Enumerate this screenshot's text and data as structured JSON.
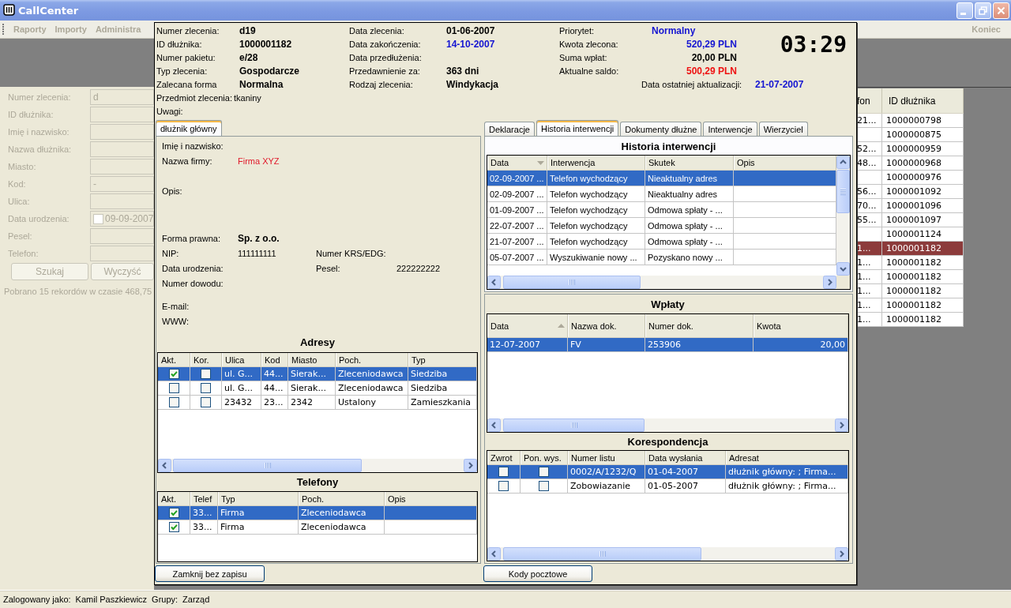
{
  "window": {
    "title": "CallCenter"
  },
  "menu": {
    "items": [
      {
        "label": "Raporty",
        "disabled": true
      },
      {
        "label": "Importy",
        "disabled": true
      },
      {
        "label": "Administra",
        "disabled": true
      }
    ],
    "end_item": {
      "label": "Koniec",
      "disabled": true
    }
  },
  "search_form": {
    "disabled": true,
    "fields": [
      {
        "kind": "text",
        "label": "Numer zlecenia:",
        "value": "d"
      },
      {
        "kind": "text",
        "label": "ID dłużnika:"
      },
      {
        "kind": "text",
        "label": "Imię i nazwisko:"
      },
      {
        "kind": "text",
        "label": "Nazwa dłużnika:"
      },
      {
        "kind": "text",
        "label": "Miasto:"
      },
      {
        "kind": "text",
        "label": "Kod:",
        "value": "-"
      },
      {
        "kind": "text",
        "label": "Ulica:"
      },
      {
        "kind": "date",
        "label": "Data urodzenia:",
        "value": "09-09-2007",
        "checked": false
      },
      {
        "kind": "text",
        "label": "Pesel:"
      },
      {
        "kind": "text",
        "label": "Telefon:"
      }
    ],
    "buttons": [
      "Szukaj",
      "Wyczyść"
    ],
    "status": "Pobrano 15 rekordów w czasie 468,75"
  },
  "results": {
    "columns": [
      "fon",
      "ID dłużnika"
    ],
    "rows": [
      {
        "column_1": "21...",
        "debtor_id": "1000000798",
        "selected": false
      },
      {
        "debtor_id": "1000000875",
        "selected": false
      },
      {
        "column_1": "52...",
        "debtor_id": "1000000959",
        "selected": false
      },
      {
        "column_1": "48...",
        "debtor_id": "1000000968",
        "selected": false
      },
      {
        "debtor_id": "1000000976",
        "selected": false
      },
      {
        "column_1": "56...",
        "debtor_id": "1000001092",
        "selected": false
      },
      {
        "column_1": "70...",
        "debtor_id": "1000001096",
        "selected": false
      },
      {
        "column_1": "55...",
        "debtor_id": "1000001097",
        "selected": false
      },
      {
        "debtor_id": "1000001124",
        "selected": false
      },
      {
        "column_1": "1...",
        "debtor_id": "1000001182",
        "selected": true
      },
      {
        "column_1": "1...",
        "debtor_id": "1000001182",
        "selected": false
      },
      {
        "column_1": "1...",
        "debtor_id": "1000001182",
        "selected": false
      },
      {
        "column_1": "1...",
        "debtor_id": "1000001182",
        "selected": false
      },
      {
        "column_1": "1...",
        "debtor_id": "1000001182",
        "selected": false
      },
      {
        "column_1": "1...",
        "debtor_id": "1000001182",
        "selected": false
      }
    ]
  },
  "order_dialog": {
    "summary": {
      "columns": [
        [
          {
            "label": "Numer zlecenia:",
            "value": "d19"
          },
          {
            "label": "ID dłużnika:",
            "value": "1000001182"
          },
          {
            "label": "Numer pakietu:",
            "value": "e/28"
          },
          {
            "label": "Typ zlecenia:",
            "value": "Gospodarcze"
          },
          {
            "label": "Zalecana forma",
            "value": "Normalna"
          }
        ],
        [
          {
            "label": "Data zlecenia:",
            "value": "01-06-2007"
          },
          {
            "label": "Data zakończenia:",
            "value": "14-10-2007",
            "color": "#1414d2"
          },
          {
            "label": "Data przedłużenia:"
          },
          {
            "label": "Przedawnienie za:",
            "value": "363 dni"
          },
          {
            "label": "Rodzaj zlecenia:",
            "value": "Windykacja"
          }
        ],
        [
          {
            "kind": "text",
            "label": "Priorytet:",
            "value": "Normalny",
            "color": "#1414d2"
          },
          {
            "kind": "amount",
            "label": "Kwota zlecona:",
            "value": "520,29 PLN",
            "color": "#1414d2"
          },
          {
            "kind": "amount",
            "label": "Suma wpłat:",
            "value": "20,00 PLN"
          },
          {
            "kind": "amount",
            "label": "Aktualne saldo:",
            "value": "500,29 PLN",
            "color": "#ee1111"
          }
        ]
      ],
      "last_update": {
        "label": "Data ostatniej aktualizacji:",
        "value": "21-07-2007",
        "color": "#1414d2"
      },
      "subject": {
        "label": "Przedmiot zlecenia:",
        "value": "tkaniny"
      },
      "notes": {
        "label": "Uwagi:"
      },
      "clock": "03:29"
    },
    "debtor_tabs": [
      {
        "label": "dłużnik główny",
        "selected": true
      }
    ],
    "debtor": {
      "sections": [
        [
          {
            "kind": "field",
            "label": "Imię i nazwisko:"
          },
          {
            "kind": "multiline",
            "label": "Nazwa firmy:",
            "value": "Firma XYZ",
            "color": "#e0182a"
          },
          {
            "kind": "memo",
            "label": "Opis:"
          },
          {
            "kind": "field",
            "label": "Forma prawna:",
            "value": "Sp. z o.o.",
            "bold": true
          },
          {
            "kind": "pair",
            "label": "NIP:",
            "value": "111111111",
            "label_2": "Numer KRS/EDG:"
          },
          {
            "kind": "pair",
            "label": "Data urodzenia:",
            "label_2": "Pesel:",
            "value_2": "222222222"
          },
          {
            "kind": "field",
            "label": "Numer dowodu:"
          }
        ],
        [
          {
            "kind": "field",
            "label": "E-mail:"
          },
          {
            "kind": "field",
            "label": "WWW:"
          }
        ]
      ]
    },
    "addresses": {
      "title": "Adresy",
      "columns": [
        {
          "label": "Akt."
        },
        {
          "label": "Kor."
        },
        {
          "label": "Ulica"
        },
        {
          "label": "Kod"
        },
        {
          "label": "Miasto"
        },
        {
          "label": "Poch."
        },
        {
          "label": "Typ"
        }
      ],
      "rows": [
        {
          "selected": true,
          "cells": [
            {
              "kind": "checkbox",
              "checked": true
            },
            {
              "kind": "checkbox",
              "checked": false
            },
            {
              "kind": "text",
              "text": "ul. G..."
            },
            {
              "kind": "text",
              "text": "44..."
            },
            {
              "kind": "text",
              "text": "Sierak..."
            },
            {
              "kind": "text",
              "text": "Zleceniodawca"
            },
            {
              "kind": "text",
              "text": "Siedziba"
            }
          ]
        },
        {
          "selected": false,
          "cells": [
            {
              "kind": "checkbox",
              "checked": false
            },
            {
              "kind": "checkbox",
              "checked": false
            },
            {
              "kind": "text",
              "text": "ul. G..."
            },
            {
              "kind": "text",
              "text": "44..."
            },
            {
              "kind": "text",
              "text": "Sierak..."
            },
            {
              "kind": "text",
              "text": "Zleceniodawca"
            },
            {
              "kind": "text",
              "text": "Siedziba"
            }
          ]
        },
        {
          "selected": false,
          "cells": [
            {
              "kind": "checkbox",
              "checked": false
            },
            {
              "kind": "checkbox",
              "checked": false
            },
            {
              "kind": "text",
              "text": "23432"
            },
            {
              "kind": "text",
              "text": "23..."
            },
            {
              "kind": "text",
              "text": "2342"
            },
            {
              "kind": "text",
              "text": "Ustalony"
            },
            {
              "kind": "text",
              "text": "Zamieszkania"
            }
          ]
        }
      ]
    },
    "phones": {
      "title": "Telefony",
      "columns": [
        {
          "label": "Akt."
        },
        {
          "label": "Telef"
        },
        {
          "label": "Typ"
        },
        {
          "label": "Poch."
        },
        {
          "label": "Opis"
        }
      ],
      "rows": [
        {
          "selected": true,
          "cells": [
            {
              "kind": "checkbox",
              "checked": true
            },
            {
              "kind": "text",
              "text": "33..."
            },
            {
              "kind": "text",
              "text": "Firma"
            },
            {
              "kind": "text",
              "text": "Zleceniodawca"
            }
          ]
        },
        {
          "selected": false,
          "cells": [
            {
              "kind": "checkbox",
              "checked": true
            },
            {
              "kind": "text",
              "text": "33..."
            },
            {
              "kind": "text",
              "text": "Firma"
            },
            {
              "kind": "text",
              "text": "Zleceniodawca"
            }
          ]
        }
      ]
    },
    "close_button": "Zamknij bez zapisu",
    "case_tabs": [
      {
        "label": "Deklaracje",
        "selected": false
      },
      {
        "label": "Historia interwencji",
        "selected": true
      },
      {
        "label": "Dokumenty dłużne",
        "selected": false
      },
      {
        "label": "Interwencje",
        "selected": false
      },
      {
        "label": "Wierzyciel",
        "selected": false
      }
    ],
    "history": {
      "title": "Historia interwencji",
      "columns": [
        {
          "label": "Data",
          "sorted": true,
          "descending": true
        },
        {
          "label": "Interwencja",
          "sorted": false
        },
        {
          "label": "Skutek",
          "sorted": false
        },
        {
          "label": "Opis",
          "sorted": false
        }
      ],
      "rows": [
        {
          "selected": true,
          "cells": [
            "02-09-2007 ...",
            "Telefon wychodzący",
            "Nieaktualny adres"
          ]
        },
        {
          "selected": false,
          "cells": [
            "02-09-2007 ...",
            "Telefon wychodzący",
            "Nieaktualny adres"
          ]
        },
        {
          "selected": false,
          "cells": [
            "01-09-2007 ...",
            "Telefon wychodzący",
            "Odmowa spłaty - ..."
          ]
        },
        {
          "selected": false,
          "cells": [
            "22-07-2007 ...",
            "Telefon wychodzący",
            "Odmowa spłaty - ..."
          ]
        },
        {
          "selected": false,
          "cells": [
            "21-07-2007 ...",
            "Telefon wychodzący",
            "Odmowa spłaty - ..."
          ]
        },
        {
          "selected": false,
          "cells": [
            "05-07-2007 ...",
            "Wyszukiwanie nowy ...",
            "Pozyskano nowy ..."
          ]
        }
      ]
    },
    "payments": {
      "title": "Wpłaty",
      "columns": [
        {
          "kind": "text",
          "label": "Data",
          "sorted": true,
          "descending": false
        },
        {
          "kind": "text",
          "label": "Nazwa dok.",
          "sorted": false
        },
        {
          "kind": "text",
          "label": "Numer dok.",
          "sorted": false
        },
        {
          "kind": "amount",
          "label": "Kwota",
          "sorted": false
        }
      ],
      "rows": [
        {
          "selected": true,
          "cells": [
            "12-07-2007",
            "FV",
            "253906",
            "20,00"
          ]
        }
      ]
    },
    "correspondence": {
      "title": "Korespondencja",
      "columns": [
        {
          "label": "Zwrot"
        },
        {
          "label": "Pon. wys."
        },
        {
          "label": "Numer listu"
        },
        {
          "label": "Data wysłania"
        },
        {
          "label": "Adresat"
        }
      ],
      "rows": [
        {
          "selected": true,
          "cells": [
            {
              "kind": "checkbox",
              "checked": false
            },
            {
              "kind": "checkbox",
              "checked": false
            },
            {
              "kind": "text",
              "text": "0002/A/1232/Q"
            },
            {
              "kind": "text",
              "text": "01-04-2007"
            },
            {
              "kind": "text",
              "text": "dłużnik główny: ; Firma..."
            }
          ]
        },
        {
          "selected": false,
          "cells": [
            {
              "kind": "checkbox",
              "checked": false
            },
            {
              "kind": "checkbox",
              "checked": false
            },
            {
              "kind": "text",
              "text": "Zobowiazanie"
            },
            {
              "kind": "text",
              "text": "01-05-2007"
            },
            {
              "kind": "text",
              "text": "dłużnik główny: ; Firma..."
            }
          ]
        }
      ]
    },
    "postal_codes_button": "Kody pocztowe"
  },
  "status_bar": {
    "items": [
      {
        "label": "Zalogowany jako:",
        "value": "Kamil Paszkiewicz"
      },
      {
        "label": "Grupy:",
        "value": "Zarząd"
      }
    ]
  }
}
